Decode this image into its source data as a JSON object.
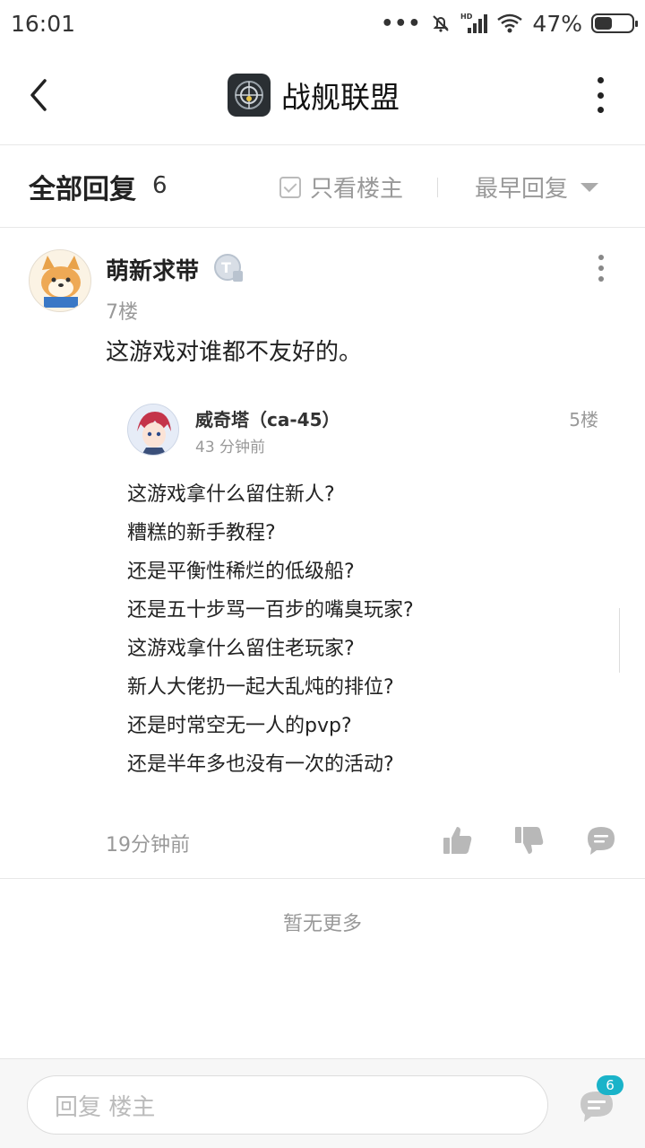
{
  "status_bar": {
    "time": "16:01",
    "dots": "•••",
    "network": "HD",
    "battery_percent_text": "47%",
    "battery_level": 0.47
  },
  "header": {
    "title": "战舰联盟",
    "back_icon": "chevron-left-icon",
    "more_icon": "more-vertical-icon"
  },
  "filter": {
    "all_replies": "全部回复",
    "count": "6",
    "only_owner": "只看楼主",
    "sort": "最早回复"
  },
  "post": {
    "username": "萌新求带",
    "floor": "7楼",
    "content": "这游戏对谁都不友好的。",
    "quote": {
      "username": "威奇塔（ca-45）",
      "time": "43 分钟前",
      "floor": "5楼",
      "lines": [
        "这游戏拿什么留住新人?",
        "糟糕的新手教程?",
        "还是平衡性稀烂的低级船?",
        "还是五十步骂一百步的嘴臭玩家?",
        "这游戏拿什么留住老玩家?",
        "新人大佬扔一起大乱炖的排位?",
        "还是时常空无一人的pvp?",
        "还是半年多也没有一次的活动?"
      ]
    },
    "time": "19分钟前"
  },
  "no_more": "暂无更多",
  "bottom": {
    "reply_placeholder": "回复  楼主",
    "badge": "6"
  },
  "colors": {
    "accent": "#1ab3c9",
    "text_primary": "#222222",
    "text_secondary": "#999999"
  }
}
